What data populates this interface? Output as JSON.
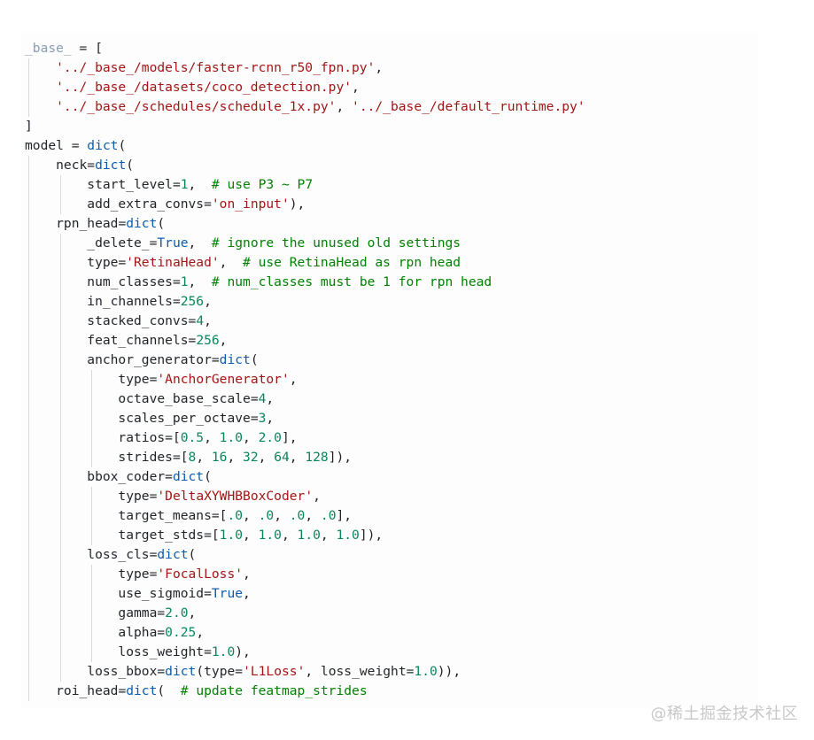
{
  "code_view": {
    "lines": [
      [
        {
          "t": "_base_",
          "c": "base"
        },
        {
          "t": " = [",
          "c": "punc"
        }
      ],
      [
        {
          "t": "    '../_base_/models/faster-rcnn_r50_fpn.py'",
          "c": "str"
        },
        {
          "t": ",",
          "c": "punc"
        }
      ],
      [
        {
          "t": "    '../_base_/datasets/coco_detection.py'",
          "c": "str"
        },
        {
          "t": ",",
          "c": "punc"
        }
      ],
      [
        {
          "t": "    '../_base_/schedules/schedule_1x.py'",
          "c": "str"
        },
        {
          "t": ", ",
          "c": "punc"
        },
        {
          "t": "'../_base_/default_runtime.py'",
          "c": "str"
        }
      ],
      [
        {
          "t": "]",
          "c": "punc"
        }
      ],
      [
        {
          "t": "model",
          "c": "var"
        },
        {
          "t": " = ",
          "c": "punc"
        },
        {
          "t": "dict",
          "c": "kw"
        },
        {
          "t": "(",
          "c": "punc"
        }
      ],
      [
        {
          "t": "    neck",
          "c": "var"
        },
        {
          "t": "=",
          "c": "punc"
        },
        {
          "t": "dict",
          "c": "kw"
        },
        {
          "t": "(",
          "c": "punc"
        }
      ],
      [
        {
          "t": "        start_level",
          "c": "var"
        },
        {
          "t": "=",
          "c": "punc"
        },
        {
          "t": "1",
          "c": "num"
        },
        {
          "t": ",  ",
          "c": "punc"
        },
        {
          "t": "# use P3 ~ P7",
          "c": "com"
        }
      ],
      [
        {
          "t": "        add_extra_convs",
          "c": "var"
        },
        {
          "t": "=",
          "c": "punc"
        },
        {
          "t": "'on_input'",
          "c": "str"
        },
        {
          "t": "),",
          "c": "punc"
        }
      ],
      [
        {
          "t": "    rpn_head",
          "c": "var"
        },
        {
          "t": "=",
          "c": "punc"
        },
        {
          "t": "dict",
          "c": "kw"
        },
        {
          "t": "(",
          "c": "punc"
        }
      ],
      [
        {
          "t": "        _delete_",
          "c": "var"
        },
        {
          "t": "=",
          "c": "punc"
        },
        {
          "t": "True",
          "c": "kw"
        },
        {
          "t": ",  ",
          "c": "punc"
        },
        {
          "t": "# ignore the unused old settings",
          "c": "com"
        }
      ],
      [
        {
          "t": "        type",
          "c": "var"
        },
        {
          "t": "=",
          "c": "punc"
        },
        {
          "t": "'RetinaHead'",
          "c": "str"
        },
        {
          "t": ",  ",
          "c": "punc"
        },
        {
          "t": "# use RetinaHead as rpn head",
          "c": "com"
        }
      ],
      [
        {
          "t": "        num_classes",
          "c": "var"
        },
        {
          "t": "=",
          "c": "punc"
        },
        {
          "t": "1",
          "c": "num"
        },
        {
          "t": ",  ",
          "c": "punc"
        },
        {
          "t": "# num_classes must be 1 for rpn head",
          "c": "com"
        }
      ],
      [
        {
          "t": "        in_channels",
          "c": "var"
        },
        {
          "t": "=",
          "c": "punc"
        },
        {
          "t": "256",
          "c": "num"
        },
        {
          "t": ",",
          "c": "punc"
        }
      ],
      [
        {
          "t": "        stacked_convs",
          "c": "var"
        },
        {
          "t": "=",
          "c": "punc"
        },
        {
          "t": "4",
          "c": "num"
        },
        {
          "t": ",",
          "c": "punc"
        }
      ],
      [
        {
          "t": "        feat_channels",
          "c": "var"
        },
        {
          "t": "=",
          "c": "punc"
        },
        {
          "t": "256",
          "c": "num"
        },
        {
          "t": ",",
          "c": "punc"
        }
      ],
      [
        {
          "t": "        anchor_generator",
          "c": "var"
        },
        {
          "t": "=",
          "c": "punc"
        },
        {
          "t": "dict",
          "c": "kw"
        },
        {
          "t": "(",
          "c": "punc"
        }
      ],
      [
        {
          "t": "            type",
          "c": "var"
        },
        {
          "t": "=",
          "c": "punc"
        },
        {
          "t": "'AnchorGenerator'",
          "c": "str"
        },
        {
          "t": ",",
          "c": "punc"
        }
      ],
      [
        {
          "t": "            octave_base_scale",
          "c": "var"
        },
        {
          "t": "=",
          "c": "punc"
        },
        {
          "t": "4",
          "c": "num"
        },
        {
          "t": ",",
          "c": "punc"
        }
      ],
      [
        {
          "t": "            scales_per_octave",
          "c": "var"
        },
        {
          "t": "=",
          "c": "punc"
        },
        {
          "t": "3",
          "c": "num"
        },
        {
          "t": ",",
          "c": "punc"
        }
      ],
      [
        {
          "t": "            ratios",
          "c": "var"
        },
        {
          "t": "=[",
          "c": "punc"
        },
        {
          "t": "0.5",
          "c": "num"
        },
        {
          "t": ", ",
          "c": "punc"
        },
        {
          "t": "1.0",
          "c": "num"
        },
        {
          "t": ", ",
          "c": "punc"
        },
        {
          "t": "2.0",
          "c": "num"
        },
        {
          "t": "],",
          "c": "punc"
        }
      ],
      [
        {
          "t": "            strides",
          "c": "var"
        },
        {
          "t": "=[",
          "c": "punc"
        },
        {
          "t": "8",
          "c": "num"
        },
        {
          "t": ", ",
          "c": "punc"
        },
        {
          "t": "16",
          "c": "num"
        },
        {
          "t": ", ",
          "c": "punc"
        },
        {
          "t": "32",
          "c": "num"
        },
        {
          "t": ", ",
          "c": "punc"
        },
        {
          "t": "64",
          "c": "num"
        },
        {
          "t": ", ",
          "c": "punc"
        },
        {
          "t": "128",
          "c": "num"
        },
        {
          "t": "]),",
          "c": "punc"
        }
      ],
      [
        {
          "t": "        bbox_coder",
          "c": "var"
        },
        {
          "t": "=",
          "c": "punc"
        },
        {
          "t": "dict",
          "c": "kw"
        },
        {
          "t": "(",
          "c": "punc"
        }
      ],
      [
        {
          "t": "            type",
          "c": "var"
        },
        {
          "t": "=",
          "c": "punc"
        },
        {
          "t": "'DeltaXYWHBBoxCoder'",
          "c": "str"
        },
        {
          "t": ",",
          "c": "punc"
        }
      ],
      [
        {
          "t": "            target_means",
          "c": "var"
        },
        {
          "t": "=[",
          "c": "punc"
        },
        {
          "t": ".0",
          "c": "num"
        },
        {
          "t": ", ",
          "c": "punc"
        },
        {
          "t": ".0",
          "c": "num"
        },
        {
          "t": ", ",
          "c": "punc"
        },
        {
          "t": ".0",
          "c": "num"
        },
        {
          "t": ", ",
          "c": "punc"
        },
        {
          "t": ".0",
          "c": "num"
        },
        {
          "t": "],",
          "c": "punc"
        }
      ],
      [
        {
          "t": "            target_stds",
          "c": "var"
        },
        {
          "t": "=[",
          "c": "punc"
        },
        {
          "t": "1.0",
          "c": "num"
        },
        {
          "t": ", ",
          "c": "punc"
        },
        {
          "t": "1.0",
          "c": "num"
        },
        {
          "t": ", ",
          "c": "punc"
        },
        {
          "t": "1.0",
          "c": "num"
        },
        {
          "t": ", ",
          "c": "punc"
        },
        {
          "t": "1.0",
          "c": "num"
        },
        {
          "t": "]),",
          "c": "punc"
        }
      ],
      [
        {
          "t": "        loss_cls",
          "c": "var"
        },
        {
          "t": "=",
          "c": "punc"
        },
        {
          "t": "dict",
          "c": "kw"
        },
        {
          "t": "(",
          "c": "punc"
        }
      ],
      [
        {
          "t": "            type",
          "c": "var"
        },
        {
          "t": "=",
          "c": "punc"
        },
        {
          "t": "'FocalLoss'",
          "c": "str"
        },
        {
          "t": ",",
          "c": "punc"
        }
      ],
      [
        {
          "t": "            use_sigmoid",
          "c": "var"
        },
        {
          "t": "=",
          "c": "punc"
        },
        {
          "t": "True",
          "c": "kw"
        },
        {
          "t": ",",
          "c": "punc"
        }
      ],
      [
        {
          "t": "            gamma",
          "c": "var"
        },
        {
          "t": "=",
          "c": "punc"
        },
        {
          "t": "2.0",
          "c": "num"
        },
        {
          "t": ",",
          "c": "punc"
        }
      ],
      [
        {
          "t": "            alpha",
          "c": "var"
        },
        {
          "t": "=",
          "c": "punc"
        },
        {
          "t": "0.25",
          "c": "num"
        },
        {
          "t": ",",
          "c": "punc"
        }
      ],
      [
        {
          "t": "            loss_weight",
          "c": "var"
        },
        {
          "t": "=",
          "c": "punc"
        },
        {
          "t": "1.0",
          "c": "num"
        },
        {
          "t": "),",
          "c": "punc"
        }
      ],
      [
        {
          "t": "        loss_bbox",
          "c": "var"
        },
        {
          "t": "=",
          "c": "punc"
        },
        {
          "t": "dict",
          "c": "kw"
        },
        {
          "t": "(",
          "c": "punc"
        },
        {
          "t": "type",
          "c": "var"
        },
        {
          "t": "=",
          "c": "punc"
        },
        {
          "t": "'L1Loss'",
          "c": "str"
        },
        {
          "t": ", ",
          "c": "punc"
        },
        {
          "t": "loss_weight",
          "c": "var"
        },
        {
          "t": "=",
          "c": "punc"
        },
        {
          "t": "1.0",
          "c": "num"
        },
        {
          "t": ")),",
          "c": "punc"
        }
      ],
      [
        {
          "t": "    roi_head",
          "c": "var"
        },
        {
          "t": "=",
          "c": "punc"
        },
        {
          "t": "dict",
          "c": "kw"
        },
        {
          "t": "(  ",
          "c": "punc"
        },
        {
          "t": "# update featmap_strides",
          "c": "com"
        }
      ]
    ]
  },
  "watermark": "@稀土掘金技术社区"
}
